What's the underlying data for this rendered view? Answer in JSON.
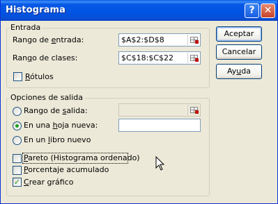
{
  "window": {
    "title": "Histograma",
    "help_glyph": "?",
    "close_glyph": "✕"
  },
  "entrada": {
    "legend": "Entrada",
    "input_range": {
      "label_pre": "Rango de ",
      "label_key": "e",
      "label_post": "ntrada:",
      "value": "$A$2:$D$8"
    },
    "bin_range": {
      "label_pre": "Ran",
      "label_key": "g",
      "label_post": "o de clases:",
      "value": "$C$18:$C$22"
    },
    "labels": {
      "label_pre": "",
      "label_key": "R",
      "label_post": "ótulos",
      "checked": false
    }
  },
  "salida": {
    "legend": "Opciones de salida",
    "output_range": {
      "label_pre": "Rango de ",
      "label_key": "s",
      "label_post": "alida:",
      "value": "",
      "selected": false
    },
    "new_sheet": {
      "label_pre": "En una ",
      "label_key": "h",
      "label_post": "oja nueva:",
      "value": "",
      "selected": true
    },
    "new_book": {
      "label_pre": "En un ",
      "label_key": "l",
      "label_post": "ibro nuevo",
      "selected": false
    },
    "pareto": {
      "label_pre": "",
      "label_key": "P",
      "label_post": "areto (Histograma ordenado)",
      "checked": false
    },
    "cumulative": {
      "label_pre": "",
      "label_key": "P",
      "label_post": "orcentaje acumulado",
      "checked": false
    },
    "chart": {
      "label_pre": "",
      "label_key": "C",
      "label_post": "rear gráfico",
      "checked": true
    }
  },
  "buttons": {
    "ok": "Aceptar",
    "cancel": "Cancelar",
    "help": {
      "pre": "Ay",
      "key": "u",
      "post": "da"
    }
  },
  "check_glyph": "✓"
}
